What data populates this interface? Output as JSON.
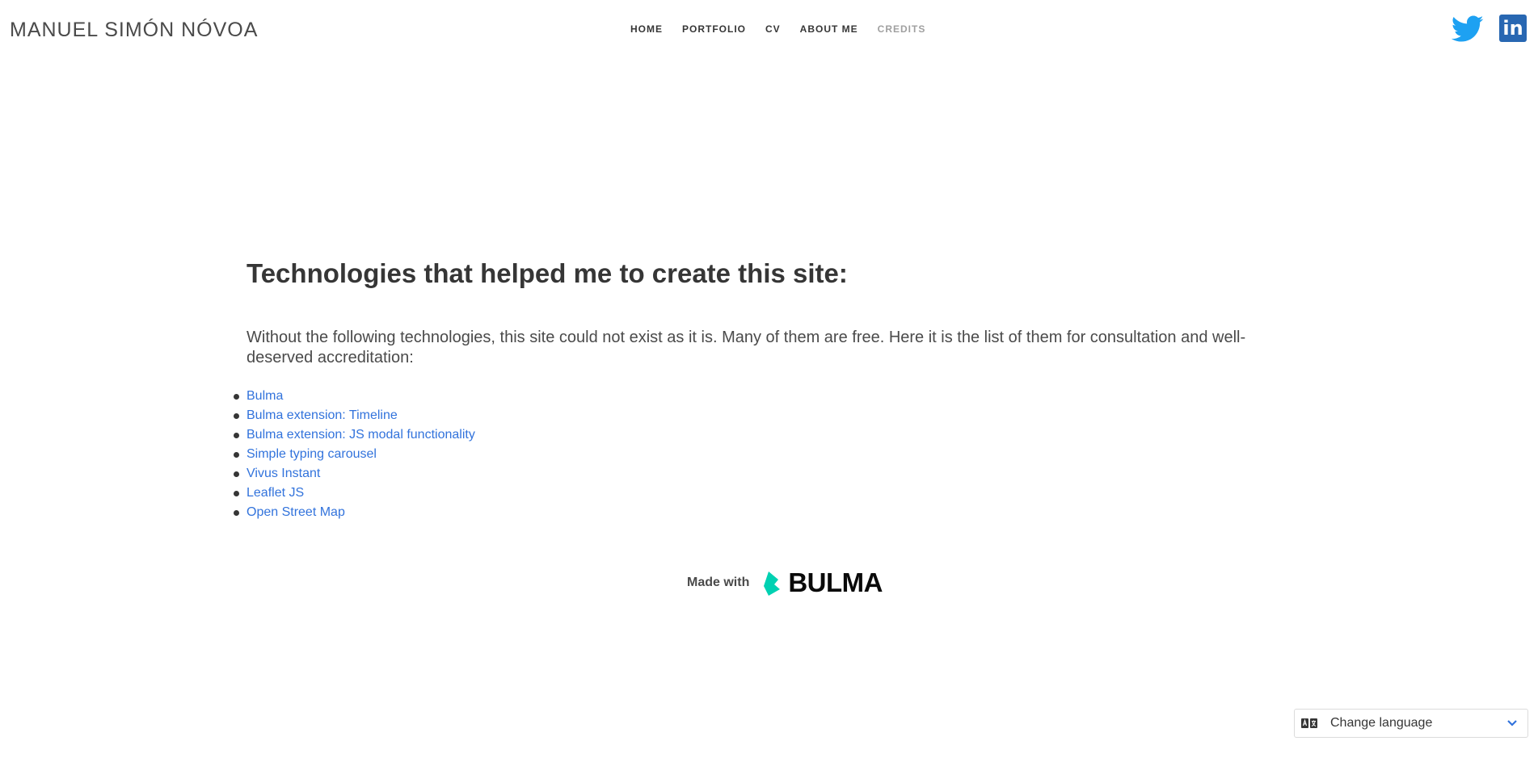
{
  "navbar": {
    "brand": "MANUEL SIMÓN NÓVOA",
    "items": [
      {
        "label": "HOME",
        "active": false
      },
      {
        "label": "PORTFOLIO",
        "active": false
      },
      {
        "label": "CV",
        "active": false
      },
      {
        "label": "ABOUT ME",
        "active": false
      },
      {
        "label": "CREDITS",
        "active": true
      }
    ],
    "social": [
      {
        "icon": "twitter-icon",
        "color": "#1da1f2"
      },
      {
        "icon": "linkedin-icon",
        "color": "#2867b2",
        "glyph": "in"
      }
    ]
  },
  "main": {
    "heading": "Technologies that helped me to create this site:",
    "intro": "Without the following technologies, this site could not exist as it is. Many of them are free. Here it is the list of them for consultation and well-deserved accreditation:",
    "technologies": [
      "Bulma",
      "Bulma extension: Timeline",
      "Bulma extension: JS modal functionality",
      "Simple typing carousel",
      "Vivus Instant",
      "Leaflet JS",
      "Open Street Map"
    ]
  },
  "footer": {
    "made_with": "Made with",
    "bulma_logo_text": "BULMA",
    "bulma_color": "#00d1b2"
  },
  "language": {
    "label": "Change language",
    "icon": "translate-icon"
  },
  "colors": {
    "link": "#3273dc",
    "text": "#363636",
    "active_nav": "#a0a0a0"
  }
}
